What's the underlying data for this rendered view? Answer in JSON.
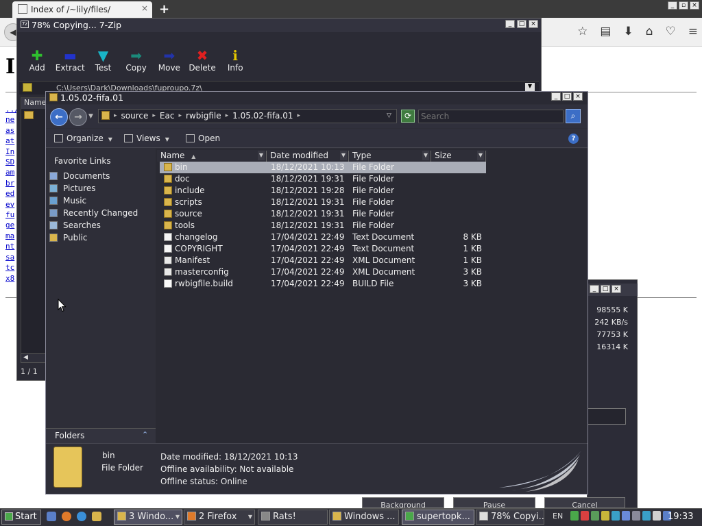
{
  "browser": {
    "tab_title": "Index of /~lily/files/",
    "tab_close": "×",
    "new_tab": "+",
    "page_heading": "I",
    "dir_links": [
      "../",
      "ne",
      "as",
      "at",
      "In",
      "SD",
      "am",
      "br",
      "ed",
      "ev",
      "fu",
      "ge",
      "ma",
      "nt",
      "sa",
      "tc",
      "x8"
    ],
    "toolbar_icons": [
      "star-icon",
      "reading-list-icon",
      "download-icon",
      "home-icon",
      "pocket-icon",
      "menu-icon"
    ]
  },
  "zip": {
    "title": "78% Copying... 7-Zip",
    "title_icon": "7z",
    "tools": [
      {
        "label": "Add",
        "icon": "add-icon",
        "glyph": "✚",
        "color": "#2fbf2f"
      },
      {
        "label": "Extract",
        "icon": "extract-icon",
        "glyph": "▬",
        "color": "#2233cc"
      },
      {
        "label": "Test",
        "icon": "test-icon",
        "glyph": "▼",
        "color": "#19b5c8"
      },
      {
        "label": "Copy",
        "icon": "copy-icon",
        "glyph": "➡",
        "color": "#1b8a7a"
      },
      {
        "label": "Move",
        "icon": "move-icon",
        "glyph": "➡",
        "color": "#2233aa"
      },
      {
        "label": "Delete",
        "icon": "delete-icon",
        "glyph": "✖",
        "color": "#e02020"
      },
      {
        "label": "Info",
        "icon": "info-icon",
        "glyph": "i",
        "color": "#e6c800"
      }
    ],
    "address": "C:\\Users\\Dark\\Downloads\\fuproupo.7z\\",
    "col_name": "Name",
    "status": "1 / 1"
  },
  "progress": {
    "stats": [
      "98555 K",
      "242 KB/s",
      "77753 K",
      "16314 K"
    ],
    "buttons": [
      "Background",
      "Pause",
      "Cancel"
    ]
  },
  "explorer": {
    "title": "1.05.02-fifa.01",
    "breadcrumbs": [
      "source",
      "Eac",
      "rwbigfile",
      "1.05.02-fifa.01"
    ],
    "search_placeholder": "Search",
    "commands": {
      "organize": "Organize",
      "views": "Views",
      "open": "Open"
    },
    "help": "?",
    "favorites_title": "Favorite Links",
    "favorites": [
      {
        "label": "Documents",
        "icon": "documents-icon",
        "color": "#8aa8d8"
      },
      {
        "label": "Pictures",
        "icon": "pictures-icon",
        "color": "#7bb0d6"
      },
      {
        "label": "Music",
        "icon": "music-icon",
        "color": "#6aa0d0"
      },
      {
        "label": "Recently Changed",
        "icon": "recently-changed-icon",
        "color": "#7a9cc8"
      },
      {
        "label": "Searches",
        "icon": "searches-icon",
        "color": "#9ab8d8"
      },
      {
        "label": "Public",
        "icon": "public-folder-icon",
        "color": "#d9b54c"
      }
    ],
    "folders_label": "Folders",
    "columns": [
      "Name",
      "Date modified",
      "Type",
      "Size"
    ],
    "files": [
      {
        "name": "bin",
        "date": "18/12/2021 10:13",
        "type": "File Folder",
        "size": "",
        "kind": "folder",
        "selected": true
      },
      {
        "name": "doc",
        "date": "18/12/2021 19:31",
        "type": "File Folder",
        "size": "",
        "kind": "folder"
      },
      {
        "name": "include",
        "date": "18/12/2021 19:28",
        "type": "File Folder",
        "size": "",
        "kind": "folder"
      },
      {
        "name": "scripts",
        "date": "18/12/2021 19:31",
        "type": "File Folder",
        "size": "",
        "kind": "folder"
      },
      {
        "name": "source",
        "date": "18/12/2021 19:31",
        "type": "File Folder",
        "size": "",
        "kind": "folder"
      },
      {
        "name": "tools",
        "date": "18/12/2021 19:31",
        "type": "File Folder",
        "size": "",
        "kind": "folder"
      },
      {
        "name": "changelog",
        "date": "17/04/2021 22:49",
        "type": "Text Document",
        "size": "8 KB",
        "kind": "doc"
      },
      {
        "name": "COPYRIGHT",
        "date": "17/04/2021 22:49",
        "type": "Text Document",
        "size": "1 KB",
        "kind": "doc"
      },
      {
        "name": "Manifest",
        "date": "17/04/2021 22:49",
        "type": "XML Document",
        "size": "1 KB",
        "kind": "xml"
      },
      {
        "name": "masterconfig",
        "date": "17/04/2021 22:49",
        "type": "XML Document",
        "size": "3 KB",
        "kind": "xml"
      },
      {
        "name": "rwbigfile.build",
        "date": "17/04/2021 22:49",
        "type": "BUILD File",
        "size": "3 KB",
        "kind": "build"
      }
    ],
    "details": {
      "name": "bin",
      "type": "File Folder",
      "date_modified": "Date modified: 18/12/2021 10:13",
      "offline_availability": "Offline availability: Not available",
      "offline_status": "Offline status: Online"
    }
  },
  "taskbar": {
    "start": "Start",
    "tasks": [
      {
        "label": "3 Windo...",
        "active": true,
        "icon_color": "#d9b54c"
      },
      {
        "label": "2 Firefox",
        "active": false,
        "icon_color": "#e07a2a"
      },
      {
        "label": "Rats!",
        "active": false,
        "icon_color": "#888888"
      },
      {
        "label": "Windows ...",
        "active": false,
        "icon_color": "#d9b54c"
      },
      {
        "label": "supertopk...",
        "active": true,
        "icon_color": "#4aa84a"
      },
      {
        "label": "78% Copyi...",
        "active": false,
        "icon_color": "#dddddd"
      }
    ],
    "language": "EN",
    "clock": "19:33"
  }
}
